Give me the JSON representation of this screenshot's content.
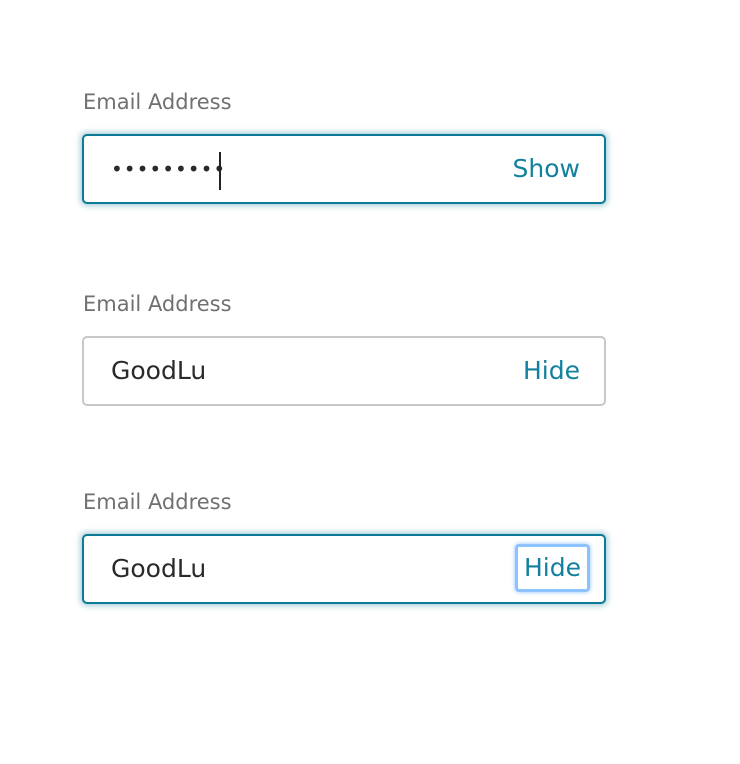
{
  "fields": [
    {
      "label": "Email Address",
      "value": "•••••••••",
      "toggle": "Show"
    },
    {
      "label": "Email Address",
      "value": "GoodLu",
      "toggle": "Hide"
    },
    {
      "label": "Email Address",
      "value": "GoodLu",
      "toggle": "Hide"
    }
  ]
}
